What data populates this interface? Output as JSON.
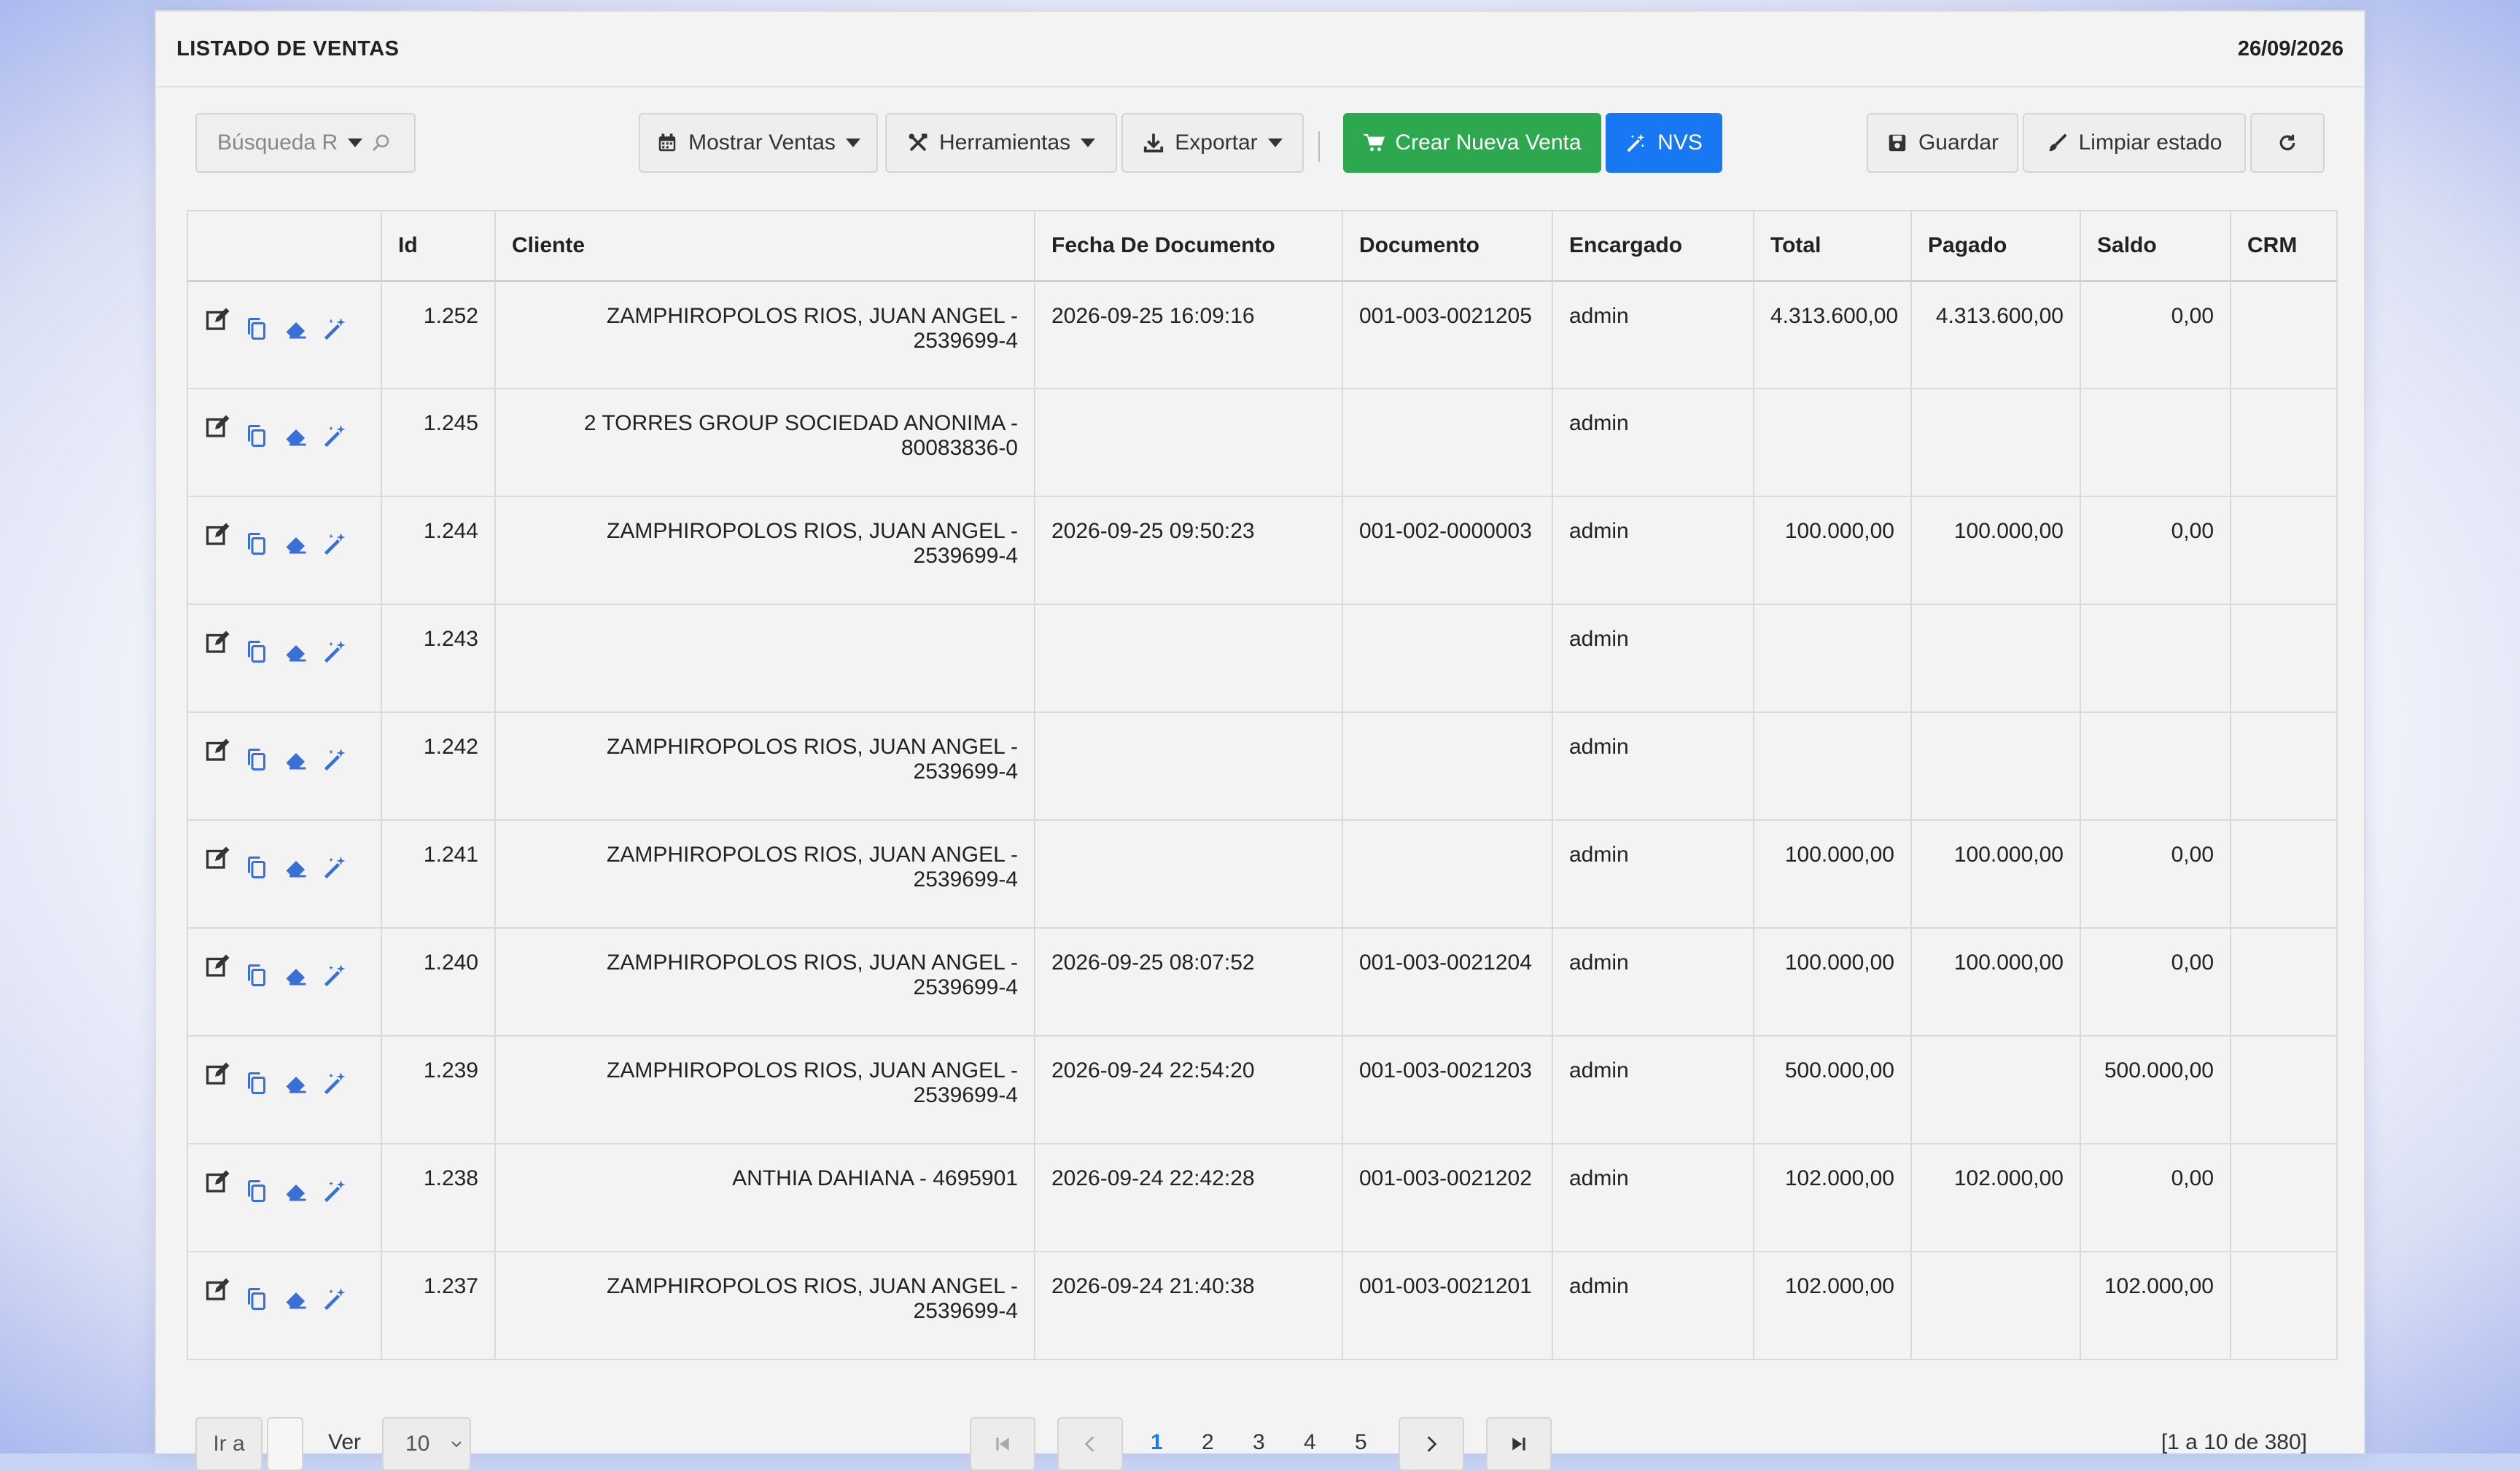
{
  "header": {
    "title": "LISTADO DE VENTAS",
    "date": "26/09/2026"
  },
  "toolbar": {
    "search_placeholder": "Búsqueda R",
    "mostrar": "Mostrar Ventas",
    "herramientas": "Herramientas",
    "exportar": "Exportar",
    "crear": "Crear Nueva Venta",
    "nvs": "NVS",
    "guardar": "Guardar",
    "limpiar": "Limpiar estado"
  },
  "table": {
    "columns": [
      "",
      "Id",
      "Cliente",
      "Fecha De Documento",
      "Documento",
      "Encargado",
      "Total",
      "Pagado",
      "Saldo",
      "CRM"
    ],
    "rows": [
      {
        "id": "1.252",
        "cliente": "ZAMPHIROPOLOS RIOS, JUAN ANGEL - 2539699-4",
        "fecha": "2026-09-25 16:09:16",
        "documento": "001-003-0021205",
        "encargado": "admin",
        "total": "4.313.600,00",
        "pagado": "4.313.600,00",
        "saldo": "0,00",
        "crm": ""
      },
      {
        "id": "1.245",
        "cliente": "2 TORRES GROUP SOCIEDAD ANONIMA - 80083836-0",
        "fecha": "",
        "documento": "",
        "encargado": "admin",
        "total": "",
        "pagado": "",
        "saldo": "",
        "crm": ""
      },
      {
        "id": "1.244",
        "cliente": "ZAMPHIROPOLOS RIOS, JUAN ANGEL - 2539699-4",
        "fecha": "2026-09-25 09:50:23",
        "documento": "001-002-0000003",
        "encargado": "admin",
        "total": "100.000,00",
        "pagado": "100.000,00",
        "saldo": "0,00",
        "crm": ""
      },
      {
        "id": "1.243",
        "cliente": "",
        "fecha": "",
        "documento": "",
        "encargado": "admin",
        "total": "",
        "pagado": "",
        "saldo": "",
        "crm": ""
      },
      {
        "id": "1.242",
        "cliente": "ZAMPHIROPOLOS RIOS, JUAN ANGEL - 2539699-4",
        "fecha": "",
        "documento": "",
        "encargado": "admin",
        "total": "",
        "pagado": "",
        "saldo": "",
        "crm": ""
      },
      {
        "id": "1.241",
        "cliente": "ZAMPHIROPOLOS RIOS, JUAN ANGEL - 2539699-4",
        "fecha": "",
        "documento": "",
        "encargado": "admin",
        "total": "100.000,00",
        "pagado": "100.000,00",
        "saldo": "0,00",
        "crm": ""
      },
      {
        "id": "1.240",
        "cliente": "ZAMPHIROPOLOS RIOS, JUAN ANGEL - 2539699-4",
        "fecha": "2026-09-25 08:07:52",
        "documento": "001-003-0021204",
        "encargado": "admin",
        "total": "100.000,00",
        "pagado": "100.000,00",
        "saldo": "0,00",
        "crm": ""
      },
      {
        "id": "1.239",
        "cliente": "ZAMPHIROPOLOS RIOS, JUAN ANGEL - 2539699-4",
        "fecha": "2026-09-24 22:54:20",
        "documento": "001-003-0021203",
        "encargado": "admin",
        "total": "500.000,00",
        "pagado": "",
        "saldo": "500.000,00",
        "crm": ""
      },
      {
        "id": "1.238",
        "cliente": "ANTHIA DAHIANA - 4695901",
        "fecha": "2026-09-24 22:42:28",
        "documento": "001-003-0021202",
        "encargado": "admin",
        "total": "102.000,00",
        "pagado": "102.000,00",
        "saldo": "0,00",
        "crm": ""
      },
      {
        "id": "1.237",
        "cliente": "ZAMPHIROPOLOS RIOS, JUAN ANGEL - 2539699-4",
        "fecha": "2026-09-24 21:40:38",
        "documento": "001-003-0021201",
        "encargado": "admin",
        "total": "102.000,00",
        "pagado": "",
        "saldo": "102.000,00",
        "crm": ""
      }
    ]
  },
  "pagination": {
    "goto_label": "Ir a",
    "ver_label": "Ver",
    "per_page": "10",
    "pages": [
      "1",
      "2",
      "3",
      "4",
      "5"
    ],
    "current_page": "1",
    "summary": "[1 a 10 de 380]"
  },
  "colors": {
    "green": "#2ea84f",
    "blue": "#1877f2",
    "icon_blue": "#3a6fd8"
  },
  "icons": [
    "search-icon",
    "calendar-icon",
    "tools-icon",
    "download-icon",
    "cart-icon",
    "magic-wand-icon",
    "save-icon",
    "brush-icon",
    "refresh-icon",
    "edit-icon",
    "copy-icon",
    "eraser-icon"
  ]
}
